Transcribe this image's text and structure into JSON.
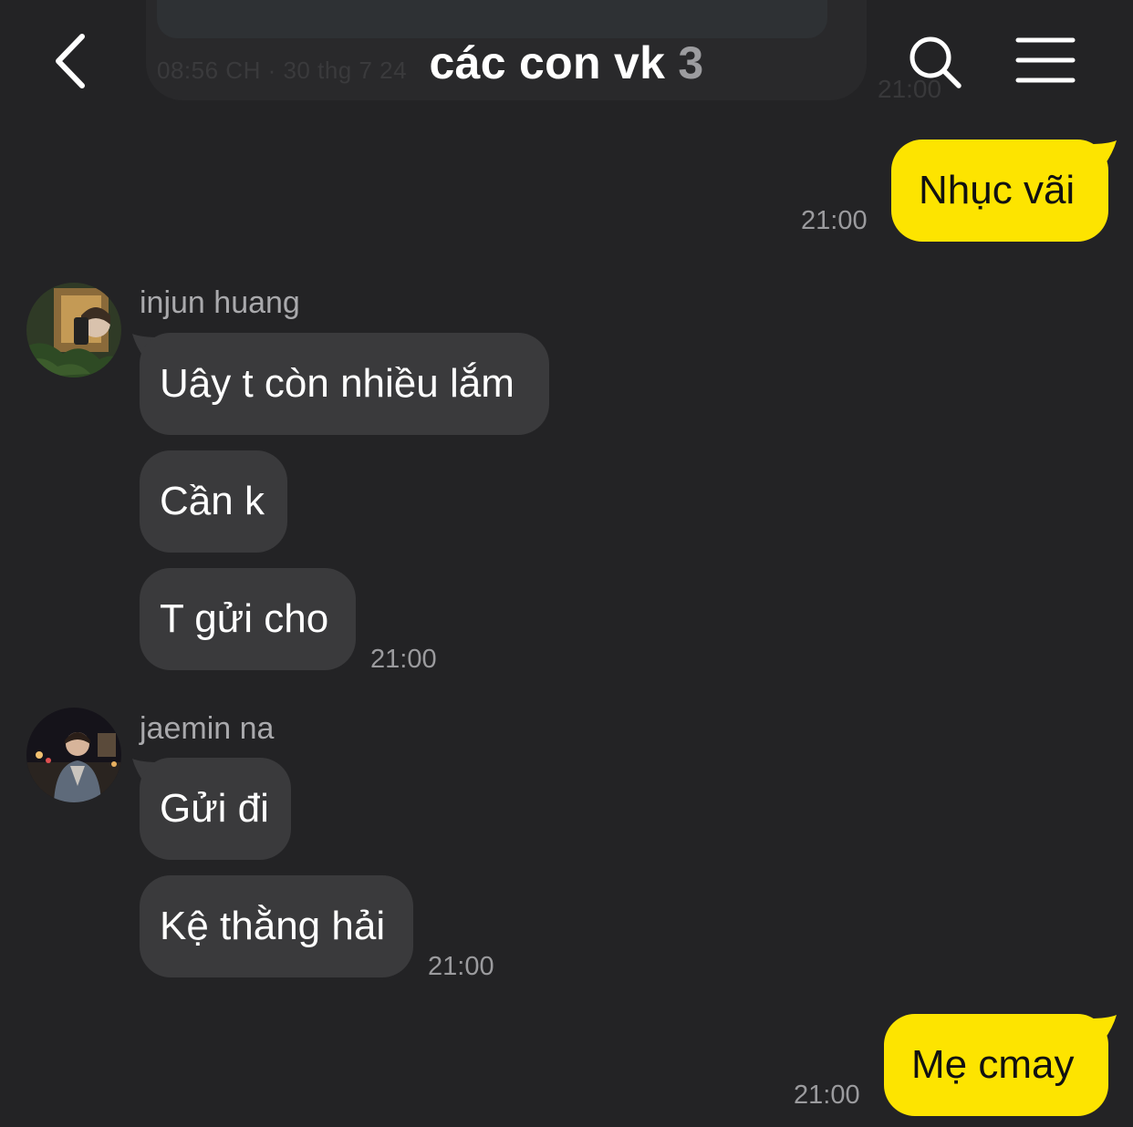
{
  "header": {
    "title": "các con vk",
    "member_count": "3",
    "back_icon": "chevron-left-icon",
    "search_icon": "search-icon",
    "menu_icon": "hamburger-menu-icon"
  },
  "previous_message": {
    "caption": "08:56 CH · 30 thg 7 24",
    "time": "21:00"
  },
  "colors": {
    "background": "#232325",
    "incoming_bubble": "#3a3a3c",
    "outgoing_bubble": "#fde400",
    "timestamp": "#9b9b9e"
  },
  "messages": {
    "m1": {
      "text": "Nhục vãi",
      "time": "21:00"
    },
    "g1": {
      "sender": "injun huang",
      "m1": "Uây t còn nhiều lắm",
      "m2": "Cần k",
      "m3": "T gửi cho",
      "time": "21:00"
    },
    "g2": {
      "sender": "jaemin na",
      "m1": "Gửi đi",
      "m2": "Kệ thằng hải",
      "time": "21:00"
    },
    "m2": {
      "text": "Mẹ cmay",
      "time": "21:00"
    }
  }
}
